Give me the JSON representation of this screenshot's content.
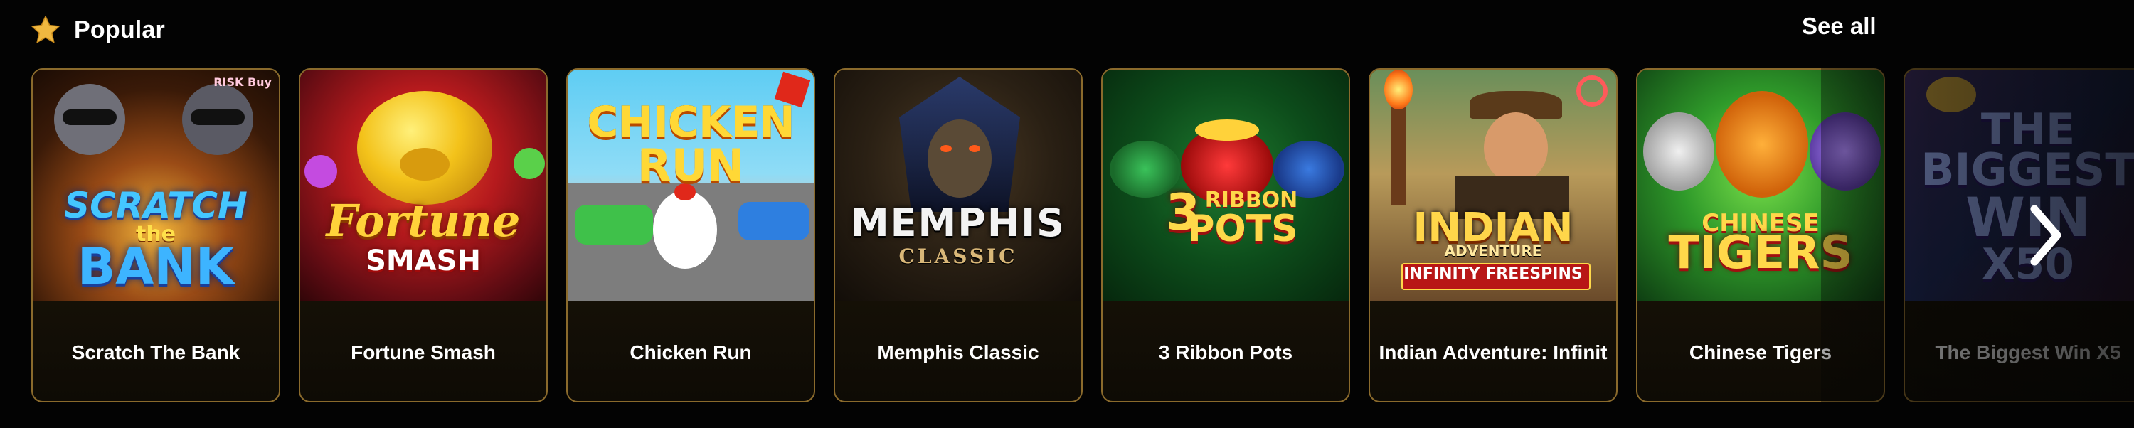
{
  "section": {
    "title": "Popular",
    "see_all": "See all",
    "title_icon": "star-icon",
    "next_icon": "chevron-right-icon"
  },
  "colors": {
    "background": "#030303",
    "card_border": "#8a6a2c",
    "card_bg": "#2d230f",
    "star": "#f0b840"
  },
  "games": [
    {
      "name": "Scratch The Bank",
      "art_lines": [
        "SCRATCH",
        "the",
        "BANK"
      ],
      "badge": "RISK Buy"
    },
    {
      "name": "Fortune Smash",
      "art_lines": [
        "Fortune",
        "SMASH"
      ]
    },
    {
      "name": "Chicken Run",
      "art_lines": [
        "CHICKEN",
        "RUN"
      ]
    },
    {
      "name": "Memphis Classic",
      "art_lines": [
        "MEMPHIS",
        "CLASSIC"
      ]
    },
    {
      "name": "3 Ribbon Pots",
      "art_lines": [
        "3",
        "RIBBON",
        "POTS"
      ]
    },
    {
      "name": "Indian Adventure: Infinit",
      "art_lines": [
        "INDIAN",
        "ADVENTURE",
        "INFINITY FREESPINS"
      ]
    },
    {
      "name": "Chinese Tigers",
      "art_lines": [
        "CHINESE",
        "TIGERS"
      ]
    },
    {
      "name": "The Biggest Win X5",
      "art_lines": [
        "THE",
        "BIGGEST",
        "WIN",
        "X50"
      ]
    }
  ]
}
